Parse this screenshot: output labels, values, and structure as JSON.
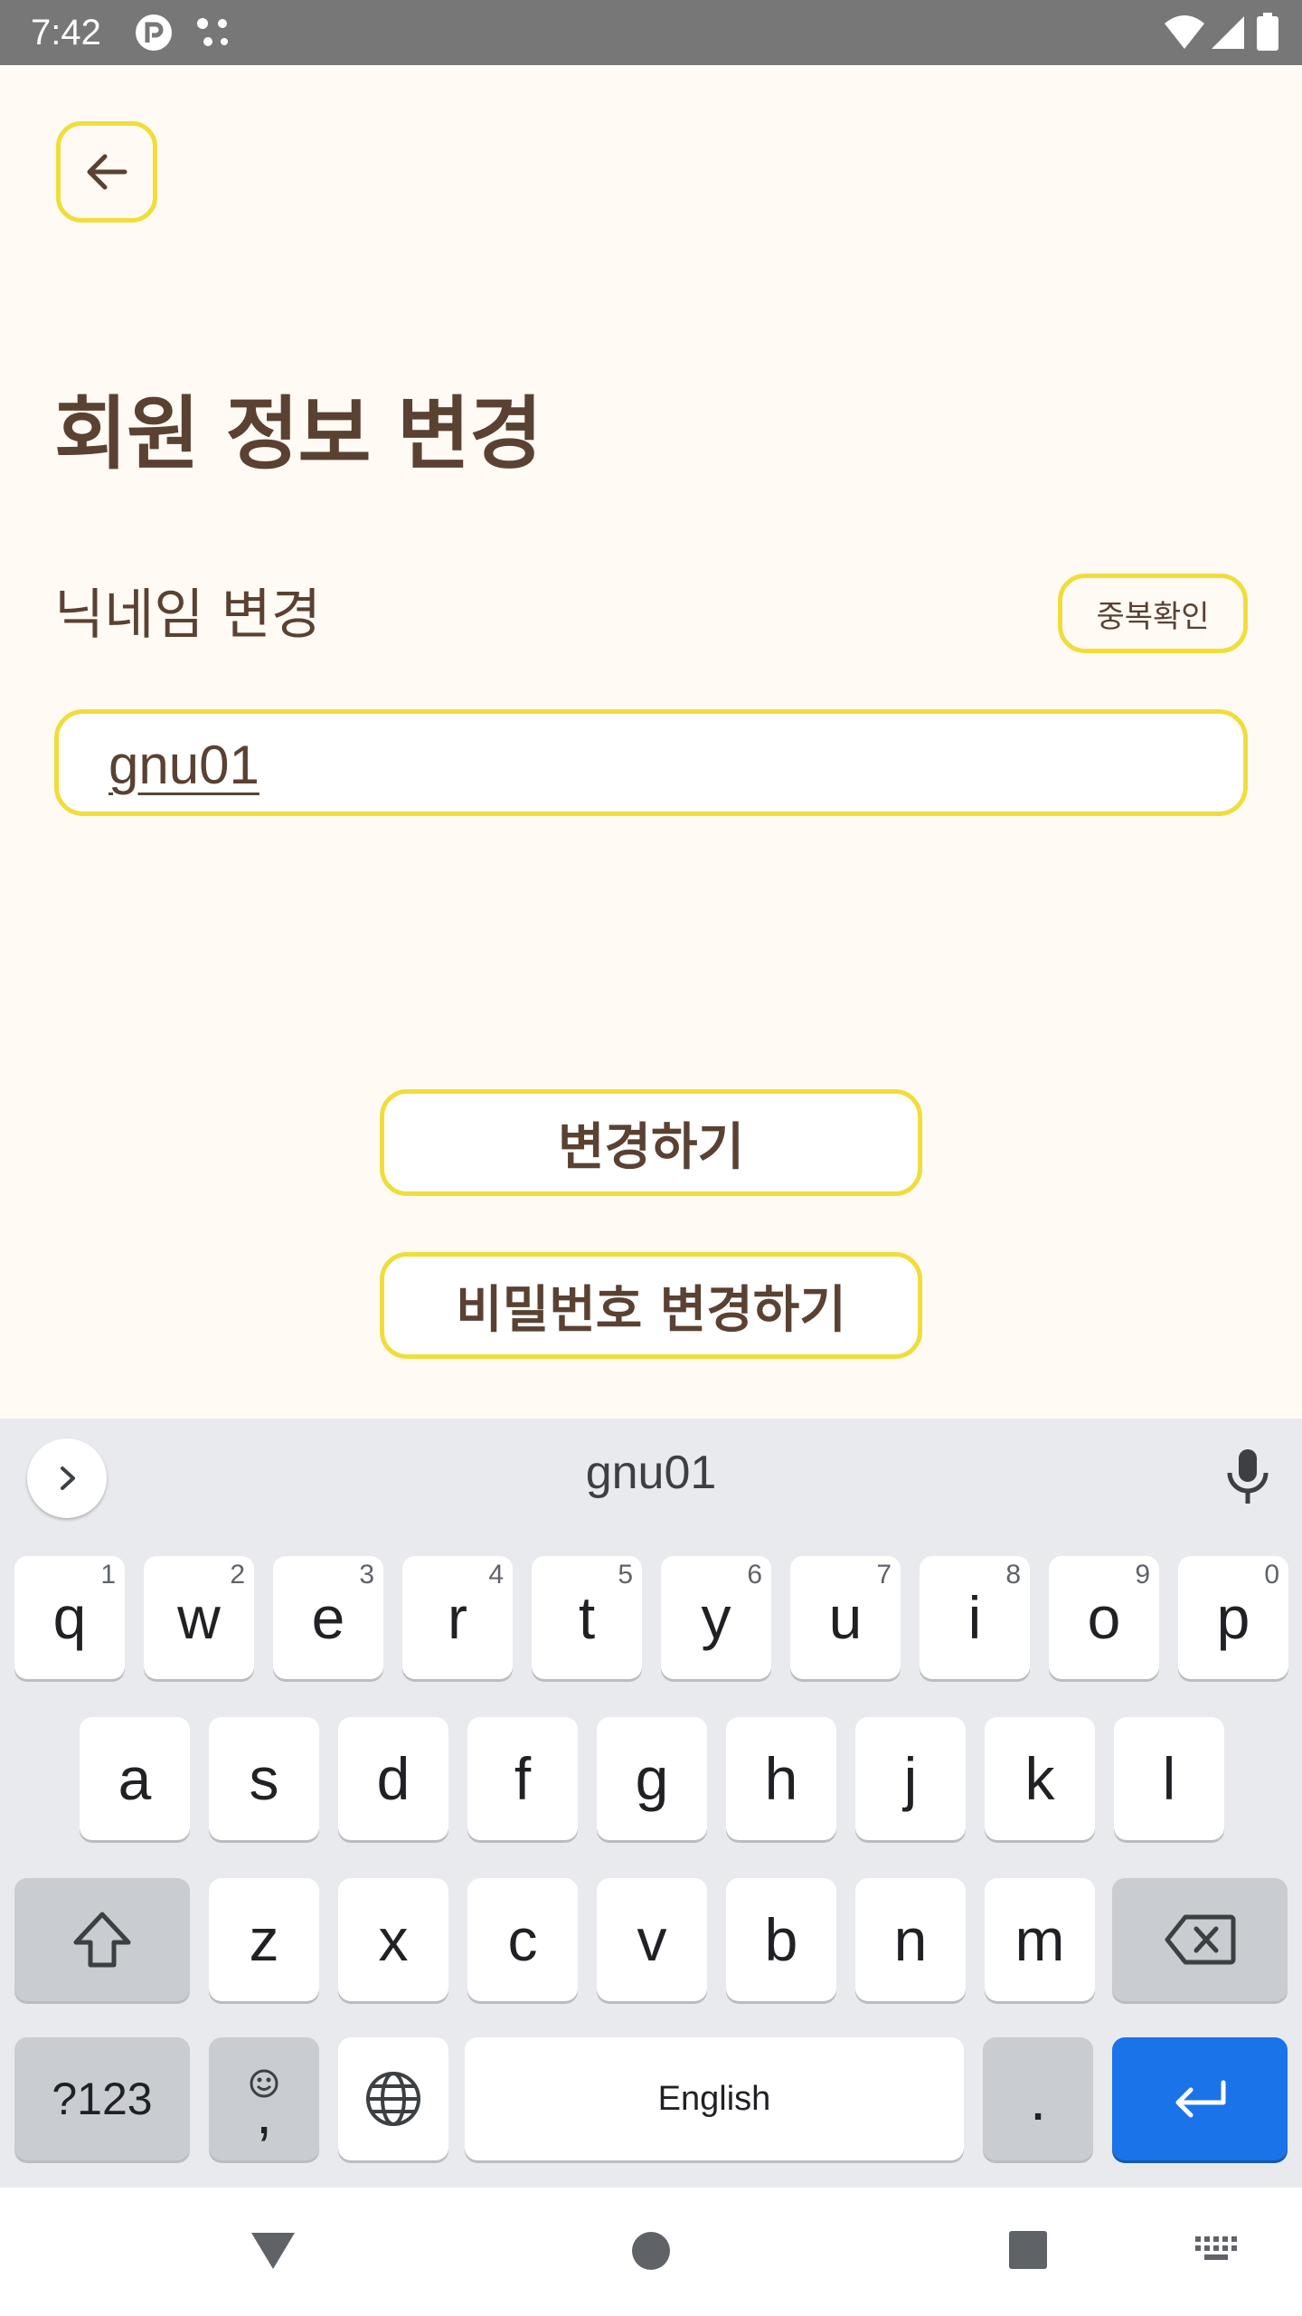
{
  "status_bar": {
    "time": "7:42",
    "icons": [
      "app-r-icon",
      "dots-icon",
      "wifi-icon",
      "signal-icon",
      "battery-icon"
    ]
  },
  "colors": {
    "background": "#fffbf4",
    "accent_border": "#f1dd3a",
    "text_brown": "#5a4132",
    "enter_key": "#1a73e8"
  },
  "header": {
    "back_icon": "arrow-left-icon",
    "title": "회원 정보 변경"
  },
  "nickname": {
    "label": "닉네임 변경",
    "duplicate_check_label": "중복확인",
    "input_value": "gnu01"
  },
  "actions": {
    "change_label": "변경하기",
    "password_change_label": "비밀번호 변경하기"
  },
  "keyboard": {
    "suggestion": "gnu01",
    "row1": [
      {
        "label": "q",
        "hint": "1"
      },
      {
        "label": "w",
        "hint": "2"
      },
      {
        "label": "e",
        "hint": "3"
      },
      {
        "label": "r",
        "hint": "4"
      },
      {
        "label": "t",
        "hint": "5"
      },
      {
        "label": "y",
        "hint": "6"
      },
      {
        "label": "u",
        "hint": "7"
      },
      {
        "label": "i",
        "hint": "8"
      },
      {
        "label": "o",
        "hint": "9"
      },
      {
        "label": "p",
        "hint": "0"
      }
    ],
    "row2": [
      "a",
      "s",
      "d",
      "f",
      "g",
      "h",
      "j",
      "k",
      "l"
    ],
    "row3": [
      "z",
      "x",
      "c",
      "v",
      "b",
      "n",
      "m"
    ],
    "symbols_label": "?123",
    "comma_label": ",",
    "space_label": "English",
    "period_label": "."
  },
  "nav_bar": {
    "icons": [
      "back-triangle-icon",
      "home-circle-icon",
      "recents-square-icon",
      "keyboard-switch-icon"
    ]
  }
}
